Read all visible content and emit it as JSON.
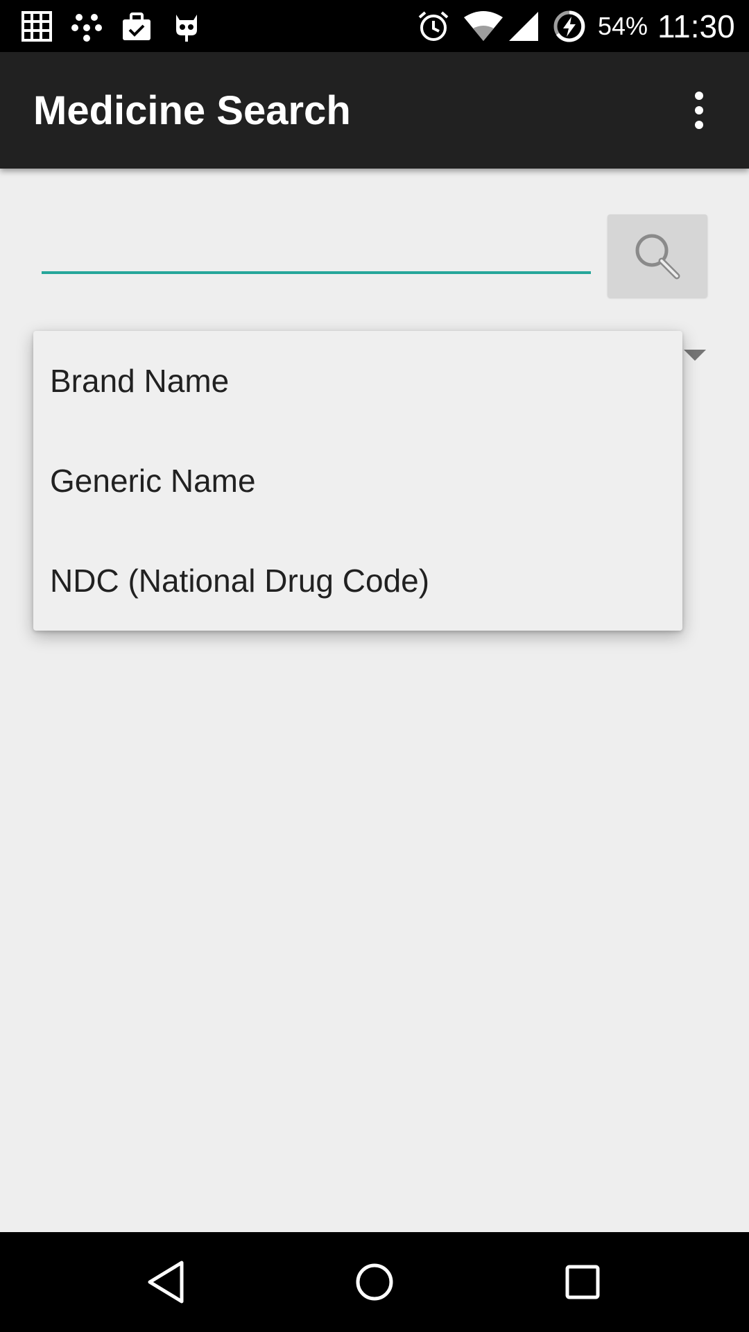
{
  "status_bar": {
    "left_icons": [
      "grid-icon",
      "dots-icon",
      "briefcase-check-icon",
      "cyanogen-icon"
    ],
    "right_icons": [
      "alarm-icon",
      "wifi-icon",
      "signal-icon",
      "battery-charging-icon"
    ],
    "battery": "54%",
    "time": "11:30"
  },
  "app_bar": {
    "title": "Medicine Search",
    "menu_icon": "overflow-menu-icon"
  },
  "search": {
    "value": "",
    "placeholder": "",
    "button_icon": "search-icon"
  },
  "spinner": {
    "arrow_icon": "dropdown-arrow-icon"
  },
  "dropdown": {
    "items": [
      {
        "label": "Brand Name"
      },
      {
        "label": "Generic Name"
      },
      {
        "label": "NDC (National Drug Code)"
      }
    ]
  },
  "nav_bar": {
    "back_icon": "back-icon",
    "home_icon": "home-icon",
    "recents_icon": "recents-icon"
  },
  "colors": {
    "accent": "#26a69a",
    "app_bar": "#212121",
    "background": "#eeeeee"
  }
}
